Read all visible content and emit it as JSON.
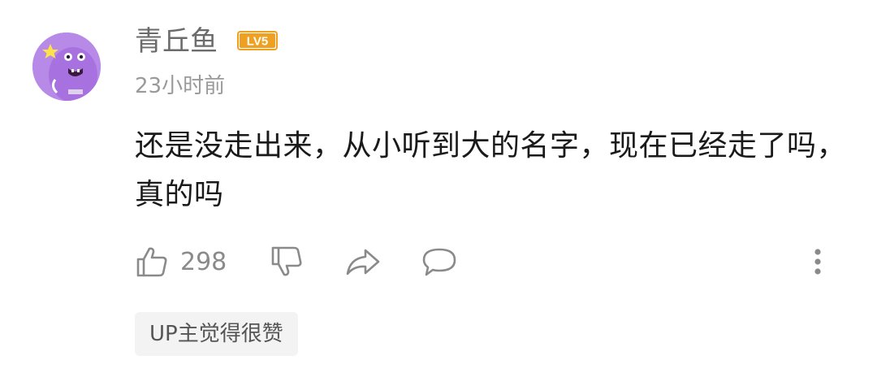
{
  "comment": {
    "username": "青丘鱼",
    "level_badge": "LV5",
    "timestamp": "23小时前",
    "text": "还是没走出来，从小听到大的名字，现在已经走了吗，真的吗",
    "like_count": "298",
    "up_tag": "UP主觉得很赞"
  },
  "icons": {
    "avatar": "purple-cartoon-avatar",
    "like": "thumbs-up-icon",
    "dislike": "thumbs-down-icon",
    "share": "share-arrow-icon",
    "reply": "chat-bubble-icon",
    "more": "vertical-dots-icon"
  },
  "colors": {
    "username": "#6b6b6b",
    "badge": "#f0a020",
    "avatar_bg": "#b88ae8",
    "text": "#1a1a1a",
    "muted": "#9a9a9a",
    "tag_bg": "#f3f3f3"
  }
}
